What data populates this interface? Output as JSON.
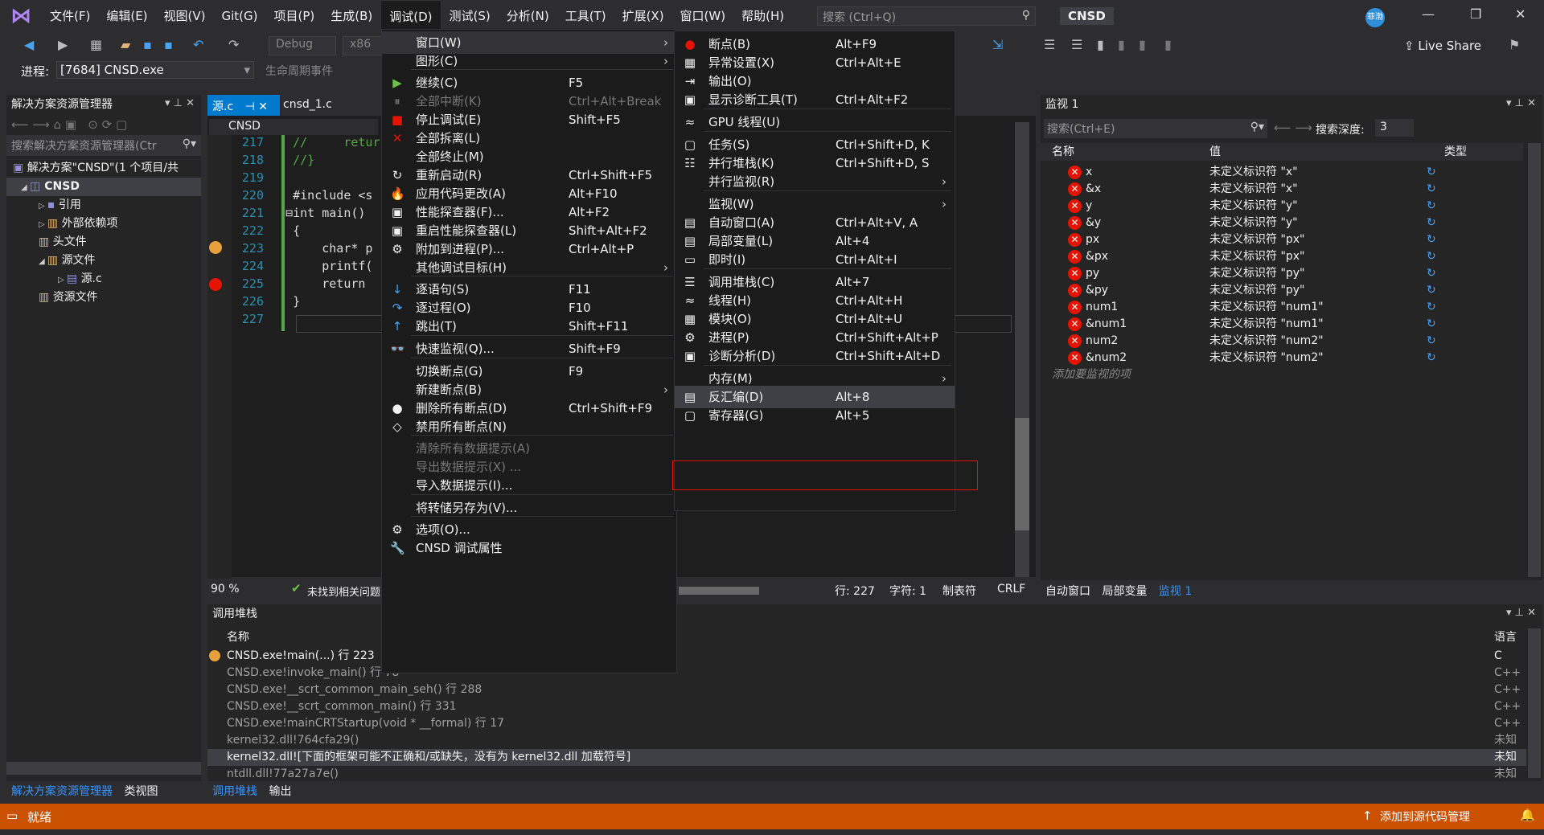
{
  "menubar": {
    "items": [
      "文件(F)",
      "编辑(E)",
      "视图(V)",
      "Git(G)",
      "项目(P)",
      "生成(B)",
      "调试(D)",
      "测试(S)",
      "分析(N)",
      "工具(T)",
      "扩展(X)",
      "窗口(W)",
      "帮助(H)"
    ],
    "search_placeholder": "搜索 (Ctrl+Q)",
    "project": "CNSD",
    "avatar": "菲渤",
    "live_share": "Live Share"
  },
  "toolbar": {
    "config": "Debug",
    "platform": "x86"
  },
  "process": {
    "label": "进程:",
    "value": "[7684] CNSD.exe",
    "lifecycle": "生命周期事件"
  },
  "solution_explorer": {
    "title": "解决方案资源管理器",
    "search": "搜索解决方案资源管理器(Ctr",
    "items": [
      "解决方案\"CNSD\"(1 个项目/共",
      "CNSD",
      "引用",
      "外部依赖项",
      "头文件",
      "源文件",
      "源.c",
      "资源文件"
    ],
    "bottom_tabs": [
      "解决方案资源管理器",
      "类视图"
    ]
  },
  "editor": {
    "tabs": [
      "源.c",
      "cnsd_1.c"
    ],
    "scope": "CNSD",
    "lines": [
      {
        "n": "217",
        "t": "    //     retur"
      },
      {
        "n": "218",
        "t": "    //}"
      },
      {
        "n": "219",
        "t": ""
      },
      {
        "n": "220",
        "t": "    #include <s"
      },
      {
        "n": "221",
        "t": "   ⊟int main()"
      },
      {
        "n": "222",
        "t": "    {"
      },
      {
        "n": "223",
        "t": "        char* p"
      },
      {
        "n": "224",
        "t": "        printf("
      },
      {
        "n": "225",
        "t": "        return "
      },
      {
        "n": "226",
        "t": "    }"
      },
      {
        "n": "227",
        "t": ""
      }
    ],
    "zoom": "90 %",
    "issues": "未找到相关问题",
    "status": {
      "line": "行: 227",
      "char": "字符: 1",
      "tab": "制表符",
      "eol": "CRLF"
    }
  },
  "debug_menu": {
    "items": [
      {
        "label": "窗口(W)",
        "shortcut": "",
        "arrow": "›",
        "icon": "",
        "disabled": false
      },
      {
        "label": "图形(C)",
        "shortcut": "",
        "arrow": "›",
        "icon": "",
        "disabled": false
      },
      {
        "label": "继续(C)",
        "shortcut": "F5",
        "arrow": "",
        "icon": "▶",
        "disabled": false
      },
      {
        "label": "全部中断(K)",
        "shortcut": "Ctrl+Alt+Break",
        "arrow": "",
        "icon": "⏸",
        "disabled": true
      },
      {
        "label": "停止调试(E)",
        "shortcut": "Shift+F5",
        "arrow": "",
        "icon": "■",
        "disabled": false
      },
      {
        "label": "全部拆离(L)",
        "shortcut": "",
        "arrow": "",
        "icon": "✕",
        "disabled": false
      },
      {
        "label": "全部终止(M)",
        "shortcut": "",
        "arrow": "",
        "icon": "",
        "disabled": false
      },
      {
        "label": "重新启动(R)",
        "shortcut": "Ctrl+Shift+F5",
        "arrow": "",
        "icon": "↻",
        "disabled": false
      },
      {
        "label": "应用代码更改(A)",
        "shortcut": "Alt+F10",
        "arrow": "",
        "icon": "🔥",
        "disabled": false
      },
      {
        "label": "性能探查器(F)...",
        "shortcut": "Alt+F2",
        "arrow": "",
        "icon": "▣",
        "disabled": false
      },
      {
        "label": "重启性能探查器(L)",
        "shortcut": "Shift+Alt+F2",
        "arrow": "",
        "icon": "▣",
        "disabled": false
      },
      {
        "label": "附加到进程(P)...",
        "shortcut": "Ctrl+Alt+P",
        "arrow": "",
        "icon": "⚙",
        "disabled": false
      },
      {
        "label": "其他调试目标(H)",
        "shortcut": "",
        "arrow": "›",
        "icon": "",
        "disabled": false
      },
      {
        "label": "逐语句(S)",
        "shortcut": "F11",
        "arrow": "",
        "icon": "↓",
        "disabled": false
      },
      {
        "label": "逐过程(O)",
        "shortcut": "F10",
        "arrow": "",
        "icon": "↷",
        "disabled": false
      },
      {
        "label": "跳出(T)",
        "shortcut": "Shift+F11",
        "arrow": "",
        "icon": "↑",
        "disabled": false
      },
      {
        "label": "快速监视(Q)...",
        "shortcut": "Shift+F9",
        "arrow": "",
        "icon": "👓",
        "disabled": false
      },
      {
        "label": "切换断点(G)",
        "shortcut": "F9",
        "arrow": "",
        "icon": "",
        "disabled": false
      },
      {
        "label": "新建断点(B)",
        "shortcut": "",
        "arrow": "›",
        "icon": "",
        "disabled": false
      },
      {
        "label": "删除所有断点(D)",
        "shortcut": "Ctrl+Shift+F9",
        "arrow": "",
        "icon": "●",
        "disabled": false
      },
      {
        "label": "禁用所有断点(N)",
        "shortcut": "",
        "arrow": "",
        "icon": "◇",
        "disabled": false
      },
      {
        "label": "清除所有数据提示(A)",
        "shortcut": "",
        "arrow": "",
        "icon": "",
        "disabled": true
      },
      {
        "label": "导出数据提示(X) ...",
        "shortcut": "",
        "arrow": "",
        "icon": "",
        "disabled": true
      },
      {
        "label": "导入数据提示(I)...",
        "shortcut": "",
        "arrow": "",
        "icon": "",
        "disabled": false
      },
      {
        "label": "将转储另存为(V)...",
        "shortcut": "",
        "arrow": "",
        "icon": "",
        "disabled": false
      },
      {
        "label": "选项(O)...",
        "shortcut": "",
        "arrow": "",
        "icon": "⚙",
        "disabled": false
      },
      {
        "label": "CNSD 调试属性",
        "shortcut": "",
        "arrow": "",
        "icon": "🔧",
        "disabled": false
      }
    ]
  },
  "window_submenu": {
    "items": [
      {
        "label": "断点(B)",
        "shortcut": "Alt+F9",
        "arrow": "",
        "icon": "●"
      },
      {
        "label": "异常设置(X)",
        "shortcut": "Ctrl+Alt+E",
        "arrow": "",
        "icon": "▦"
      },
      {
        "label": "输出(O)",
        "shortcut": "",
        "arrow": "",
        "icon": "⇥"
      },
      {
        "label": "显示诊断工具(T)",
        "shortcut": "Ctrl+Alt+F2",
        "arrow": "",
        "icon": "▣"
      },
      {
        "label": "GPU 线程(U)",
        "shortcut": "",
        "arrow": "",
        "icon": "≈"
      },
      {
        "label": "任务(S)",
        "shortcut": "Ctrl+Shift+D, K",
        "arrow": "",
        "icon": "▢"
      },
      {
        "label": "并行堆栈(K)",
        "shortcut": "Ctrl+Shift+D, S",
        "arrow": "",
        "icon": "☷"
      },
      {
        "label": "并行监视(R)",
        "shortcut": "",
        "arrow": "›",
        "icon": ""
      },
      {
        "label": "监视(W)",
        "shortcut": "",
        "arrow": "›",
        "icon": ""
      },
      {
        "label": "自动窗口(A)",
        "shortcut": "Ctrl+Alt+V, A",
        "arrow": "",
        "icon": "▤"
      },
      {
        "label": "局部变量(L)",
        "shortcut": "Alt+4",
        "arrow": "",
        "icon": "▤"
      },
      {
        "label": "即时(I)",
        "shortcut": "Ctrl+Alt+I",
        "arrow": "",
        "icon": "▭"
      },
      {
        "label": "调用堆栈(C)",
        "shortcut": "Alt+7",
        "arrow": "",
        "icon": "☰"
      },
      {
        "label": "线程(H)",
        "shortcut": "Ctrl+Alt+H",
        "arrow": "",
        "icon": "≈"
      },
      {
        "label": "模块(O)",
        "shortcut": "Ctrl+Alt+U",
        "arrow": "",
        "icon": "▦"
      },
      {
        "label": "进程(P)",
        "shortcut": "Ctrl+Shift+Alt+P",
        "arrow": "",
        "icon": "⚙"
      },
      {
        "label": "诊断分析(D)",
        "shortcut": "Ctrl+Shift+Alt+D",
        "arrow": "",
        "icon": "▣"
      },
      {
        "label": "内存(M)",
        "shortcut": "",
        "arrow": "›",
        "icon": ""
      },
      {
        "label": "反汇编(D)",
        "shortcut": "Alt+8",
        "arrow": "",
        "icon": "▤"
      },
      {
        "label": "寄存器(G)",
        "shortcut": "Alt+5",
        "arrow": "",
        "icon": "▢"
      }
    ]
  },
  "watch": {
    "title": "监视 1",
    "search": "搜索(Ctrl+E)",
    "depth_label": "搜索深度:",
    "depth": "3",
    "headers": [
      "名称",
      "值",
      "类型"
    ],
    "rows": [
      {
        "name": "x",
        "value": "未定义标识符 \"x\""
      },
      {
        "name": "&x",
        "value": "未定义标识符 \"x\""
      },
      {
        "name": "y",
        "value": "未定义标识符 \"y\""
      },
      {
        "name": "&y",
        "value": "未定义标识符 \"y\""
      },
      {
        "name": "px",
        "value": "未定义标识符 \"px\""
      },
      {
        "name": "&px",
        "value": "未定义标识符 \"px\""
      },
      {
        "name": "py",
        "value": "未定义标识符 \"py\""
      },
      {
        "name": "&py",
        "value": "未定义标识符 \"py\""
      },
      {
        "name": "num1",
        "value": "未定义标识符 \"num1\""
      },
      {
        "name": "&num1",
        "value": "未定义标识符 \"num1\""
      },
      {
        "name": "num2",
        "value": "未定义标识符 \"num2\""
      },
      {
        "name": "&num2",
        "value": "未定义标识符 \"num2\""
      }
    ],
    "add_hint": "添加要监视的项",
    "tabs": [
      "自动窗口",
      "局部变量",
      "监视 1"
    ]
  },
  "callstack": {
    "title": "调用堆栈",
    "headers": [
      "名称",
      "语言"
    ],
    "rows": [
      {
        "name": "CNSD.exe!main(...) 行 223",
        "lang": "C"
      },
      {
        "name": "CNSD.exe!invoke_main() 行 78",
        "lang": "C++"
      },
      {
        "name": "CNSD.exe!__scrt_common_main_seh() 行 288",
        "lang": "C++"
      },
      {
        "name": "CNSD.exe!__scrt_common_main() 行 331",
        "lang": "C++"
      },
      {
        "name": "CNSD.exe!mainCRTStartup(void * __formal) 行 17",
        "lang": "C++"
      },
      {
        "name": "kernel32.dll!764cfa29()",
        "lang": "未知"
      },
      {
        "name": "kernel32.dll![下面的框架可能不正确和/或缺失，没有为 kernel32.dll 加载符号]",
        "lang": "未知"
      },
      {
        "name": "ntdll.dll!77a27a7e()",
        "lang": "未知"
      }
    ],
    "tabs": [
      "调用堆栈",
      "输出"
    ]
  },
  "statusbar": {
    "ready": "就绪",
    "source_control": "添加到源代码管理"
  },
  "colors": {
    "accent": "#007acc",
    "status": "#ca5100",
    "highlight_border": "#e51400"
  }
}
